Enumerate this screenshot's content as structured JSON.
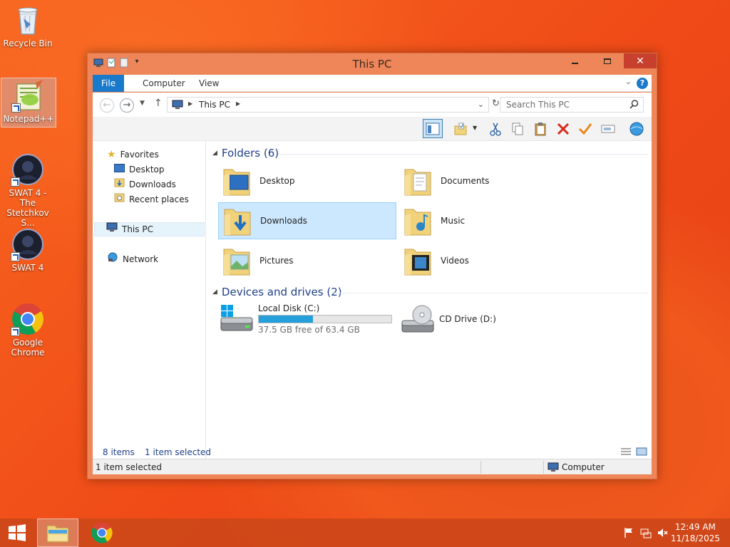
{
  "desktop": {
    "icons": [
      {
        "label": "Recycle Bin"
      },
      {
        "label": "Notepad++"
      },
      {
        "label": "SWAT 4 - The Stetchkov S..."
      },
      {
        "label": "SWAT 4"
      },
      {
        "label": "Google Chrome"
      }
    ]
  },
  "window": {
    "title": "This PC",
    "ribbon_tabs": [
      "File",
      "Computer",
      "View"
    ],
    "help_label": "?",
    "address_path": "This PC",
    "search_placeholder": "Search This PC",
    "nav_pane": {
      "favorites": "Favorites",
      "favorites_items": [
        "Desktop",
        "Downloads",
        "Recent places"
      ],
      "this_pc": "This PC",
      "network": "Network"
    },
    "folders_group": "Folders (6)",
    "folders": [
      {
        "name": "Desktop",
        "selected": false
      },
      {
        "name": "Documents",
        "selected": false
      },
      {
        "name": "Downloads",
        "selected": true
      },
      {
        "name": "Music",
        "selected": false
      },
      {
        "name": "Pictures",
        "selected": false
      },
      {
        "name": "Videos",
        "selected": false
      }
    ],
    "devices_group": "Devices and drives (2)",
    "drives": [
      {
        "name": "Local Disk (C:)",
        "free_text": "37.5 GB free of 63.4 GB",
        "used_fraction": 0.41
      },
      {
        "name": "CD Drive (D:)"
      }
    ],
    "item_count": "8 items",
    "selection_count": "1 item selected",
    "status_left": "1 item selected",
    "status_right": "Computer"
  },
  "taskbar": {
    "time": "12:49 AM",
    "date": "11/18/2025"
  },
  "colors": {
    "accent": "#1979ca",
    "selection": "#cce8ff",
    "drive_bar": "#26a0da",
    "window_frame": "#ef8659"
  }
}
